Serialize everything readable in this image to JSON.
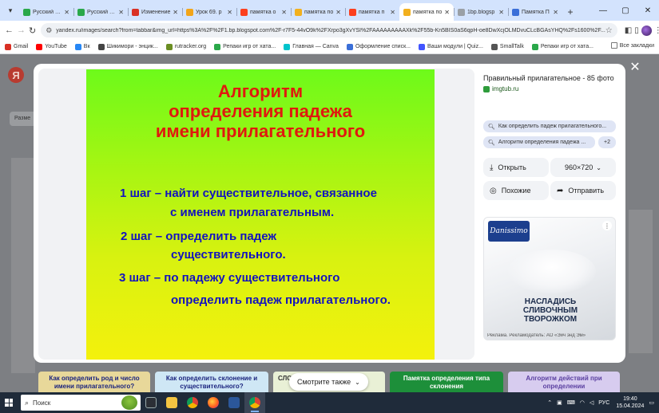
{
  "browser": {
    "tabs": [
      {
        "title": "Русский язык",
        "color": "#2aa84a"
      },
      {
        "title": "Русский язык",
        "color": "#2aa84a"
      },
      {
        "title": "Изменение",
        "color": "#d93025"
      },
      {
        "title": "Урок 69. р",
        "color": "#f2a51a"
      },
      {
        "title": "памятка о",
        "color": "#fc3f1d"
      },
      {
        "title": "памятка по",
        "color": "#f2b01e"
      },
      {
        "title": "памятка п",
        "color": "#fc3f1d"
      },
      {
        "title": "памятка по",
        "color": "#f2b01e",
        "active": true
      },
      {
        "title": "1bp.blogsp",
        "color": "#9aa0a6"
      },
      {
        "title": "Памятка П",
        "color": "#3b6fd8"
      }
    ],
    "url": "yandex.ru/images/search?from=tabbar&img_url=https%3A%2F%2F1.bp.blogspot.com%2F-r7F5-44vO9k%2FXrpo3gXvYSI%2FAAAAAAAAAXk%2F55b-Kn5BIS0aS6qpH-oe8DwXcjOLMDvuCLcBGAsYHQ%2Fs1600%2F...",
    "bookmarks": [
      {
        "label": "Gmail",
        "color": "#d93025"
      },
      {
        "label": "YouTube",
        "color": "#ff0000"
      },
      {
        "label": "Вк",
        "color": "#2787f5"
      },
      {
        "label": "Шикимори - энцик...",
        "color": "#444444"
      },
      {
        "label": "rutracker.org",
        "color": "#6b8e23"
      },
      {
        "label": "Репаки игр от хата...",
        "color": "#2aa84a"
      },
      {
        "label": "Главная — Canva",
        "color": "#00c4cc"
      },
      {
        "label": "Оформление списк...",
        "color": "#3b6fd8"
      },
      {
        "label": "Ваши модули | Quiz...",
        "color": "#4255ff"
      },
      {
        "label": "SmallTalk",
        "color": "#555555"
      },
      {
        "label": "Репаки игр от хата...",
        "color": "#2aa84a"
      }
    ],
    "all_bookmarks": "Все закладки"
  },
  "page": {
    "logo": "Я",
    "size_filter": "Разме"
  },
  "viewer": {
    "slide": {
      "title_lines": [
        "Алгоритм",
        "определения падежа",
        "имени прилагательного"
      ],
      "steps": [
        "1 шаг – найти существительное, связанное",
        "с именем прилагательным.",
        "2 шаг – определить падеж",
        "существительного.",
        "3 шаг – по падежу существительного",
        "определить падеж прилагательного."
      ]
    },
    "panel": {
      "title": "Правильный прилагательное - 85 фото",
      "source": "imgtub.ru",
      "chips": [
        "Как определить падеж прилагательного...",
        "Алгоритм определения падежа ...",
        "+2"
      ],
      "open_label": "Открыть",
      "resolution": "960×720",
      "similar_label": "Похожие",
      "send_label": "Отправить"
    },
    "ad": {
      "brand": "Danissimo",
      "headline_lines": [
        "НАСЛАДИСЬ",
        "СЛИВОЧНЫМ",
        "ТВОРОЖКОМ"
      ],
      "disclaimer": "Реклама. Рекламодатель: АО «Эйч энд Эм»"
    },
    "thumbnails": [
      {
        "text": "Как определить род и число имени прилагательного?",
        "bg": "#e8d89a",
        "fg": "#1a237e"
      },
      {
        "text": "Как определить склонение и существительного?",
        "bg": "#cfe7f5",
        "fg": "#1a237e"
      },
      {
        "text": "СЛОВ СУЩ",
        "bg": "#e9f0d6",
        "fg": "#333333"
      },
      {
        "text": "Памятка определения типа склонения",
        "bg": "#1d8f3a",
        "fg": "#ffffff"
      },
      {
        "text": "Алгоритм действий при определении",
        "bg": "#d7ccef",
        "fg": "#5a3fa0"
      }
    ],
    "see_also": "Смотрите также"
  },
  "taskbar": {
    "search": "Поиск",
    "lang": "РУС",
    "time": "19:40",
    "date": "15.04.2024"
  }
}
